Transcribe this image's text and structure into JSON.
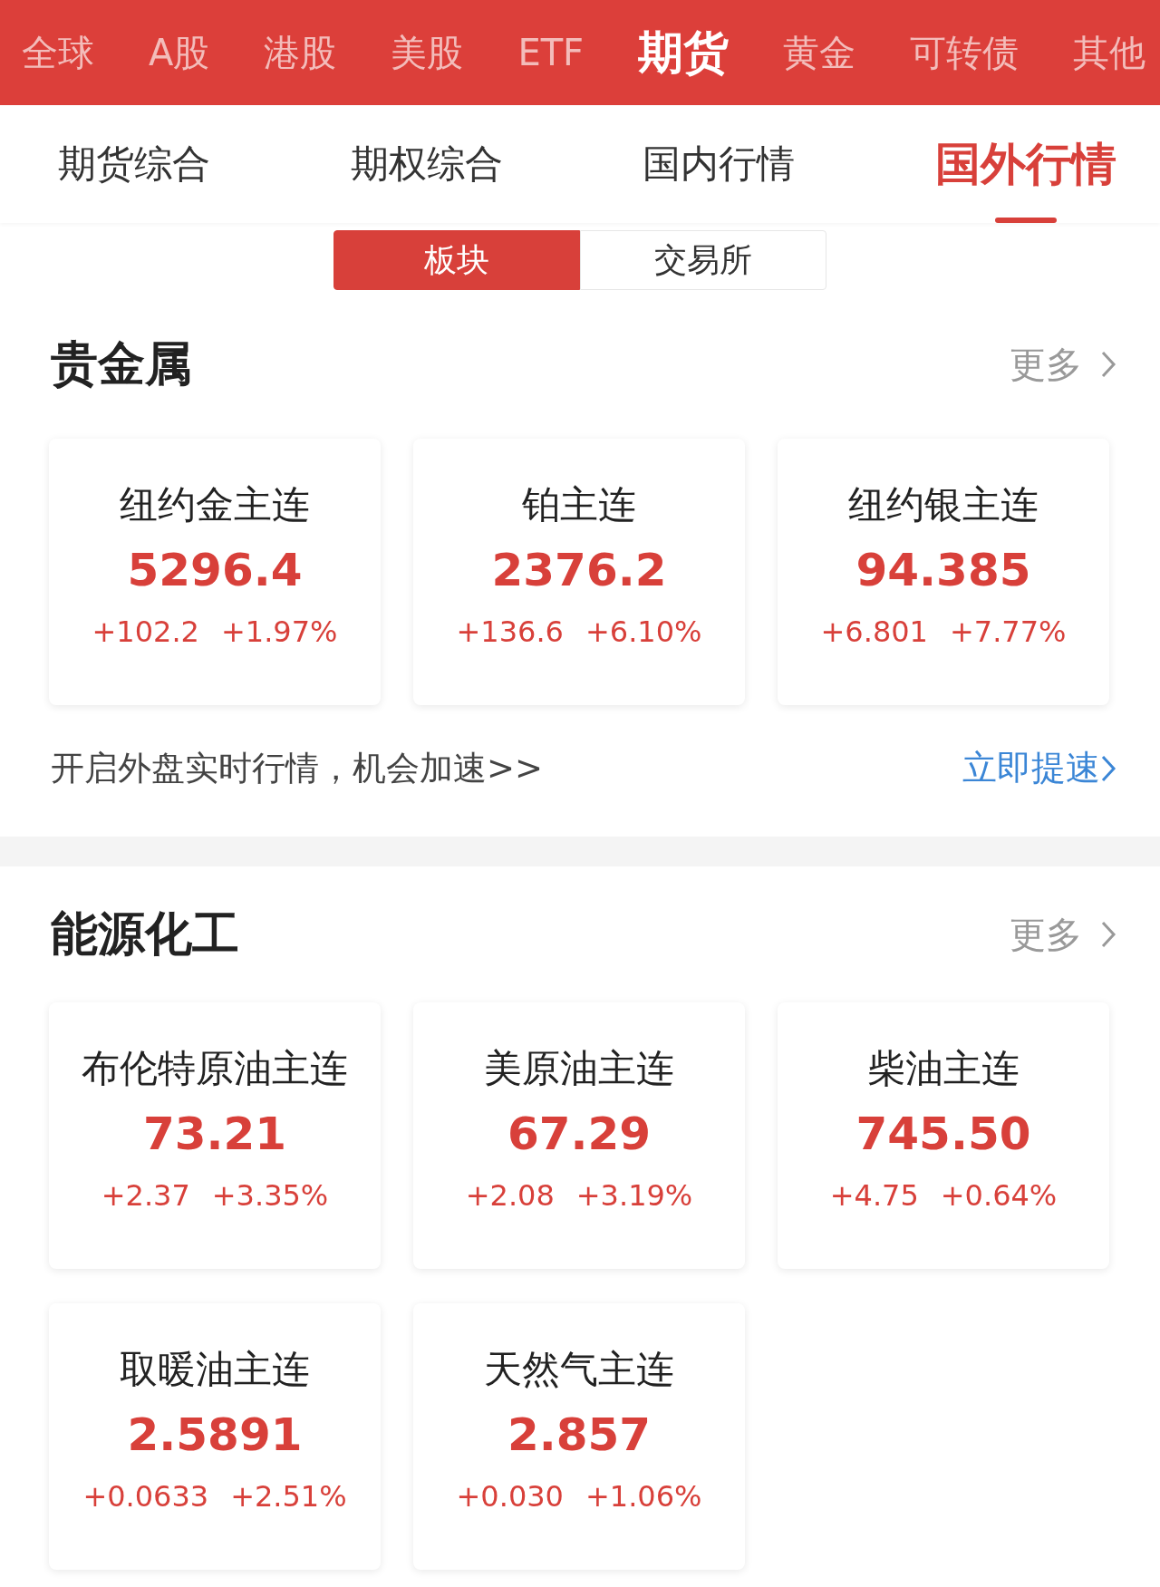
{
  "top_nav": [
    {
      "label": "全球",
      "selected": false
    },
    {
      "label": "A股",
      "selected": false
    },
    {
      "label": "港股",
      "selected": false
    },
    {
      "label": "美股",
      "selected": false
    },
    {
      "label": "ETF",
      "selected": false
    },
    {
      "label": "期货",
      "selected": true
    },
    {
      "label": "黄金",
      "selected": false
    },
    {
      "label": "可转债",
      "selected": false
    },
    {
      "label": "其他",
      "selected": false
    }
  ],
  "sub_tabs": [
    {
      "label": "期货综合",
      "selected": false
    },
    {
      "label": "期权综合",
      "selected": false
    },
    {
      "label": "国内行情",
      "selected": false
    },
    {
      "label": "国外行情",
      "selected": true
    }
  ],
  "segments": [
    {
      "label": "板块",
      "selected": true
    },
    {
      "label": "交易所",
      "selected": false
    }
  ],
  "sections": [
    {
      "title": "贵金属",
      "more": "更多",
      "items": [
        {
          "name": "纽约金主连",
          "price": "5296.4",
          "change": "+102.2",
          "percent": "+1.97%"
        },
        {
          "name": "铂主连",
          "price": "2376.2",
          "change": "+136.6",
          "percent": "+6.10%"
        },
        {
          "name": "纽约银主连",
          "price": "94.385",
          "change": "+6.801",
          "percent": "+7.77%"
        }
      ],
      "promo": {
        "text": "开启外盘实时行情，机会加速>>",
        "link": "立即提速"
      }
    },
    {
      "title": "能源化工",
      "more": "更多",
      "items": [
        {
          "name": "布伦特原油主连",
          "price": "73.21",
          "change": "+2.37",
          "percent": "+3.35%"
        },
        {
          "name": "美原油主连",
          "price": "67.29",
          "change": "+2.08",
          "percent": "+3.19%"
        },
        {
          "name": "柴油主连",
          "price": "745.50",
          "change": "+4.75",
          "percent": "+0.64%"
        },
        {
          "name": "取暖油主连",
          "price": "2.5891",
          "change": "+0.0633",
          "percent": "+2.51%"
        },
        {
          "name": "天然气主连",
          "price": "2.857",
          "change": "+0.030",
          "percent": "+1.06%"
        }
      ]
    }
  ]
}
